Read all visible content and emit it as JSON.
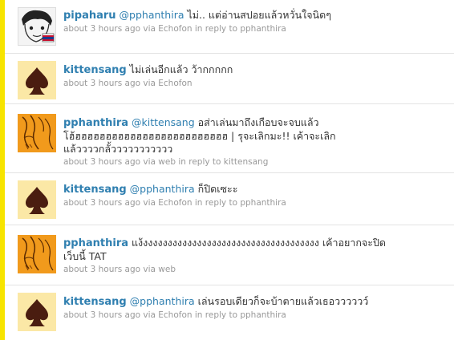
{
  "tweets": [
    {
      "user": "pipaharu",
      "mention": "@pphanthira",
      "text": " ไม่.. แต่อ่านสปอยแล้วหวั่นใจนิดๆ",
      "meta": "about 3 hours ago via Echofon in reply to pphanthira",
      "avatar": "manga-drawing-avatar"
    },
    {
      "user": "kittensang",
      "mention": "",
      "text": " ไม่เล่นอีกแล้ว ว้ากกกกก",
      "meta": "about 3 hours ago via Echofon",
      "avatar": "spade-avatar"
    },
    {
      "user": "pphanthira",
      "mention": "@kittensang",
      "text": " อส่าเล่นมาถึงเกือบจะจบแล้ว โฮ้ฮฮฮฮฮฮฮฮฮฮฮฮฮฮฮฮฮฮฮฮฮฮฮฮฮ | รุจะเลิกมะ!! เค้าจะเลิกแล้ววววกลั้ววววววววววว",
      "meta": "about 3 hours ago via web in reply to kittensang",
      "avatar": "orange-sketch-avatar"
    },
    {
      "user": "kittensang",
      "mention": "@pphanthira",
      "text": " ก็ปิดเซะะ",
      "meta": "about 3 hours ago via Echofon in reply to pphanthira",
      "avatar": "spade-avatar"
    },
    {
      "user": "pphanthira",
      "mention": "",
      "text": " แง้งงงงงงงงงงงงงงงงงงงงงงงงงงงงงงงงงงงง เค้าอยากจะปิดเว็บนี้ TAT",
      "meta": "about 3 hours ago via web",
      "avatar": "orange-sketch-avatar"
    },
    {
      "user": "kittensang",
      "mention": "@pphanthira",
      "text": " เล่นรอบเดียวก็จะบ้าตายแล้วเธอวววววว์",
      "meta": "about 3 hours ago via Echofon in reply to pphanthira",
      "avatar": "spade-avatar"
    }
  ],
  "colors": {
    "link": "#2f7fb0",
    "meta": "#999999",
    "stripe": "#f7e400",
    "spade_bg": "#fbe8a6",
    "spade": "#4a1d10",
    "orange_avatar": "#f19a1c"
  }
}
